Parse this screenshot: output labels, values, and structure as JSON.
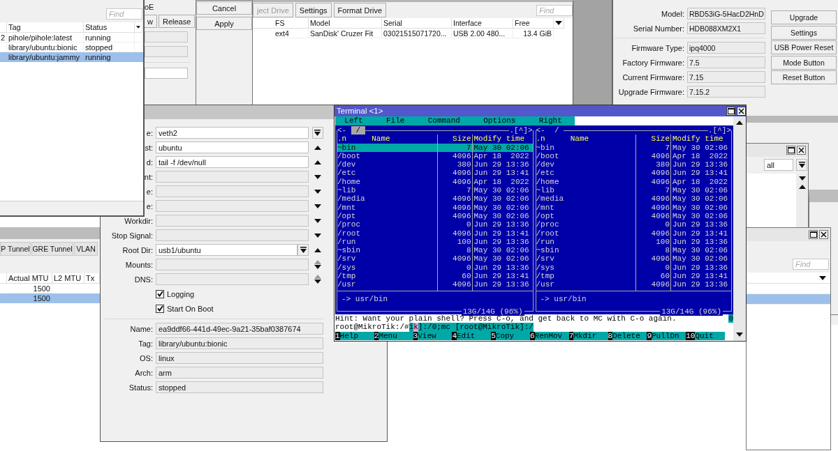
{
  "routerboard_window": {
    "field_groups": [
      [
        {
          "label": "Model:",
          "value": "RBD53iG-5HacD2HnD"
        },
        {
          "label": "Serial Number:",
          "value": "HDB088XM2X1"
        }
      ],
      [
        {
          "label": "Firmware Type:",
          "value": "ipq4000"
        },
        {
          "label": "Factory Firmware:",
          "value": "7.5"
        },
        {
          "label": "Current Firmware:",
          "value": "7.15"
        },
        {
          "label": "Upgrade Firmware:",
          "value": "7.15.2"
        }
      ]
    ],
    "buttons": [
      "Upgrade",
      "Settings",
      "USB Power Reset",
      "Mode Button",
      "Reset Button"
    ]
  },
  "disks_window": {
    "toolbar": [
      {
        "label": "ject Drive",
        "disabled": true
      },
      {
        "label": "Settings",
        "disabled": false
      },
      {
        "label": "Format Drive",
        "disabled": false
      }
    ],
    "search": {
      "placeholder": "Find"
    },
    "table": {
      "columns": [
        "FS",
        "Model",
        "Serial",
        "Interface",
        "Free"
      ],
      "rows": [
        [
          "ext4",
          "SanDisk' Cruzer Fit",
          "03021515071720...",
          "USB 2.00 480...",
          "13.4 GiB"
        ]
      ]
    }
  },
  "pppoe_window": {
    "label": "oE",
    "buttons": [
      "w",
      "Release"
    ],
    "dialog_buttons": [
      "Cancel",
      "Apply"
    ]
  },
  "filter_window": {
    "filter": {
      "value": "all"
    }
  },
  "list_window": {
    "search": {
      "placeholder": "Find"
    }
  },
  "containers_list": {
    "search": {
      "placeholder": "Find"
    },
    "columns": [
      "Tag",
      "Status"
    ],
    "rows": [
      {
        "column_1": "2",
        "tag": "pihole/pihole:latest",
        "status": "running",
        "selected": false
      },
      {
        "tag": "library/ubuntu:bionic",
        "status": "stopped",
        "selected": false
      },
      {
        "tag": "library/ubuntu:jammy",
        "status": "running",
        "selected": true
      }
    ]
  },
  "interface_window": {
    "tabs": [
      {
        "label": "P Tunnel",
        "selected": false
      },
      {
        "label": "GRE Tunnel",
        "selected": false
      },
      {
        "label": "VLAN",
        "selected": false
      }
    ],
    "columns": [
      "Actual MTU",
      "L2 MTU",
      "Tx"
    ],
    "rows": [
      {
        "actual_mtu": "1500",
        "selected": false
      },
      {
        "actual_mtu": "1500",
        "selected": true
      }
    ]
  },
  "container_window": {
    "fields": [
      {
        "label": "e:",
        "value": "veth2",
        "dropdown": false,
        "kind": "dropdown"
      },
      {
        "label": "st:",
        "value": "ubuntu",
        "dropdown": false,
        "kind": "up"
      },
      {
        "label": "d:",
        "value": "tail -f /dev/null",
        "dropdown": false,
        "kind": "up"
      },
      {
        "label": "nt:",
        "dropdown": false,
        "kind": "down"
      },
      {
        "label": "e:",
        "dropdown": false,
        "kind": "down"
      },
      {
        "label": "e:",
        "dropdown": false,
        "kind": "down"
      },
      {
        "label": "Workdir:",
        "dropdown": false,
        "kind": "down"
      },
      {
        "label": "Stop Signal:",
        "dropdown": false,
        "kind": "down"
      },
      {
        "label": "Root Dir:",
        "value": "usb1/ubuntu",
        "dropdown": true,
        "kind": "up"
      },
      {
        "label": "Mounts:",
        "dropdown": false,
        "kind": "updown"
      },
      {
        "label": "DNS:",
        "dropdown": false,
        "kind": "updown"
      }
    ],
    "checkboxes": [
      {
        "label": "Logging",
        "checked": true
      },
      {
        "label": "Start On Boot",
        "checked": true
      }
    ],
    "info": [
      {
        "label": "Name:",
        "value": "ea9ddf66-441d-49ec-9a21-35baf0387674"
      },
      {
        "label": "Tag:",
        "value": "library/ubuntu:bionic"
      },
      {
        "label": "OS:",
        "value": "linux"
      },
      {
        "label": "Arch:",
        "value": "arm"
      },
      {
        "label": "Status:",
        "value": "stopped"
      }
    ]
  },
  "terminal": {
    "title": "Terminal <1>",
    "menu": [
      "Left",
      "File",
      "Command",
      "Options",
      "Right"
    ],
    "panels": [
      {
        "back_mark": "<-",
        "path": "/",
        "path_selected": true,
        "history_mark": ".[^]>",
        "columns": [
          ".n",
          "Name",
          "Size",
          "Modify time"
        ],
        "rows": [
          {
            "name": "~bin",
            "size": "7",
            "time": "May 30 02:06",
            "selected": true
          },
          {
            "name": "/boot",
            "size": "4096",
            "time": "Apr 18  2022",
            "selected": false
          },
          {
            "name": "/dev",
            "size": "380",
            "time": "Jun 29 13:36",
            "selected": false
          },
          {
            "name": "/etc",
            "size": "4096",
            "time": "Jun 29 13:41",
            "selected": false
          },
          {
            "name": "/home",
            "size": "4096",
            "time": "Apr 18  2022",
            "selected": false
          },
          {
            "name": "~lib",
            "size": "7",
            "time": "May 30 02:06",
            "selected": false
          },
          {
            "name": "/media",
            "size": "4096",
            "time": "May 30 02:06",
            "selected": false
          },
          {
            "name": "/mnt",
            "size": "4096",
            "time": "May 30 02:06",
            "selected": false
          },
          {
            "name": "/opt",
            "size": "4096",
            "time": "May 30 02:06",
            "selected": false
          },
          {
            "name": "/proc",
            "size": "0",
            "time": "Jun 29 13:36",
            "selected": false
          },
          {
            "name": "/root",
            "size": "4096",
            "time": "Jun 29 13:41",
            "selected": false
          },
          {
            "name": "/run",
            "size": "100",
            "time": "Jun 29 13:36",
            "selected": false
          },
          {
            "name": "~sbin",
            "size": "8",
            "time": "May 30 02:06",
            "selected": false
          },
          {
            "name": "/srv",
            "size": "4096",
            "time": "May 30 02:06",
            "selected": false
          },
          {
            "name": "/sys",
            "size": "0",
            "time": "Jun 29 13:36",
            "selected": false
          },
          {
            "name": "/tmp",
            "size": "60",
            "time": "Jun 29 13:41",
            "selected": false
          },
          {
            "name": "/usr",
            "size": "4096",
            "time": "Jun 29 13:36",
            "selected": false
          }
        ],
        "link": "-> usr/bin",
        "usage": "13G/14G (96%)"
      },
      {
        "back_mark": "<-",
        "path": "/",
        "path_selected": false,
        "history_mark": ".[^]>",
        "columns": [
          ".n",
          "Name",
          "Size",
          "Modify time"
        ],
        "rows": [
          {
            "name": "~bin",
            "size": "7",
            "time": "May 30 02:06",
            "selected": false
          },
          {
            "name": "/boot",
            "size": "4096",
            "time": "Apr 18  2022",
            "selected": false
          },
          {
            "name": "/dev",
            "size": "380",
            "time": "Jun 29 13:36",
            "selected": false
          },
          {
            "name": "/etc",
            "size": "4096",
            "time": "Jun 29 13:41",
            "selected": false
          },
          {
            "name": "/home",
            "size": "4096",
            "time": "Apr 18  2022",
            "selected": false
          },
          {
            "name": "~lib",
            "size": "7",
            "time": "May 30 02:06",
            "selected": false
          },
          {
            "name": "/media",
            "size": "4096",
            "time": "May 30 02:06",
            "selected": false
          },
          {
            "name": "/mnt",
            "size": "4096",
            "time": "May 30 02:06",
            "selected": false
          },
          {
            "name": "/opt",
            "size": "4096",
            "time": "May 30 02:06",
            "selected": false
          },
          {
            "name": "/proc",
            "size": "0",
            "time": "Jun 29 13:36",
            "selected": false
          },
          {
            "name": "/root",
            "size": "4096",
            "time": "Jun 29 13:41",
            "selected": false
          },
          {
            "name": "/run",
            "size": "100",
            "time": "Jun 29 13:36",
            "selected": false
          },
          {
            "name": "~sbin",
            "size": "8",
            "time": "May 30 02:06",
            "selected": false
          },
          {
            "name": "/srv",
            "size": "4096",
            "time": "May 30 02:06",
            "selected": false
          },
          {
            "name": "/sys",
            "size": "0",
            "time": "Jun 29 13:36",
            "selected": false
          },
          {
            "name": "/tmp",
            "size": "60",
            "time": "Jun 29 13:41",
            "selected": false
          },
          {
            "name": "/usr",
            "size": "4096",
            "time": "Jun 29 13:36",
            "selected": false
          }
        ],
        "link": "-> usr/bin",
        "usage": "13G/14G (96%)"
      }
    ],
    "hint": "Hint: Want your plain shell? Press C-o, and get back to MC with C-o again.",
    "hint_mark": "0",
    "prompt": [
      {
        "text": "root@MikroTik:/#",
        "kind": "plain"
      },
      {
        "text": "i",
        "kind": "teal"
      },
      {
        "text": "k",
        "kind": "pink"
      },
      {
        "text": "]:/0;mc [root@MikroTik]:/",
        "kind": "teal"
      }
    ],
    "keys": [
      {
        "num": "1",
        "label": "Help"
      },
      {
        "num": "2",
        "label": "Menu"
      },
      {
        "num": "3",
        "label": "View"
      },
      {
        "num": "4",
        "label": "Edit"
      },
      {
        "num": "5",
        "label": "Copy"
      },
      {
        "num": "6",
        "label": "RenMov"
      },
      {
        "num": "7",
        "label": "Mkdir"
      },
      {
        "num": "8",
        "label": "Delete"
      },
      {
        "num": "9",
        "label": "PullDn"
      },
      {
        "num": "10",
        "label": "Quit"
      }
    ]
  }
}
